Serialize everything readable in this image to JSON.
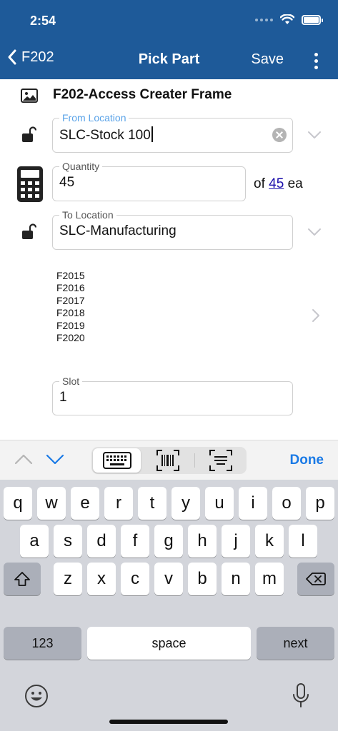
{
  "status_bar": {
    "time": "2:54"
  },
  "nav": {
    "back_label": "F202",
    "title": "Pick Part",
    "save_label": "Save"
  },
  "part": {
    "name": "F202-Access Creater Frame"
  },
  "from_location": {
    "label": "From Location",
    "value": "SLC-Stock 100"
  },
  "quantity": {
    "label": "Quantity",
    "value": "45",
    "of_text": "of",
    "total": "45",
    "unit": "ea"
  },
  "to_location": {
    "label": "To Location",
    "value": "SLC-Manufacturing"
  },
  "bins": [
    "F2015",
    "F2016",
    "F2017",
    "F2018",
    "F2019",
    "F2020"
  ],
  "slot": {
    "label": "Slot",
    "value": "1"
  },
  "toolbar": {
    "done_label": "Done"
  },
  "keyboard": {
    "row1": [
      "q",
      "w",
      "e",
      "r",
      "t",
      "y",
      "u",
      "i",
      "o",
      "p"
    ],
    "row2": [
      "a",
      "s",
      "d",
      "f",
      "g",
      "h",
      "j",
      "k",
      "l"
    ],
    "row3": [
      "z",
      "x",
      "c",
      "v",
      "b",
      "n",
      "m"
    ],
    "numbers_label": "123",
    "space_label": "space",
    "next_label": "next"
  },
  "colors": {
    "header": "#1e5a99",
    "accent": "#1a7ae6",
    "link": "#1a0dab",
    "active_label": "#5aa3e8",
    "keyboard_bg": "#d3d5db"
  },
  "icons": [
    "wifi-icon",
    "battery-icon",
    "back-chevron-icon",
    "more-icon",
    "image-icon",
    "unlock-icon",
    "calculator-icon",
    "chevron-down-icon",
    "chevron-right-icon",
    "keyboard-icon",
    "barcode-icon",
    "text-scan-icon",
    "shift-icon",
    "backspace-icon",
    "emoji-icon",
    "microphone-icon"
  ]
}
